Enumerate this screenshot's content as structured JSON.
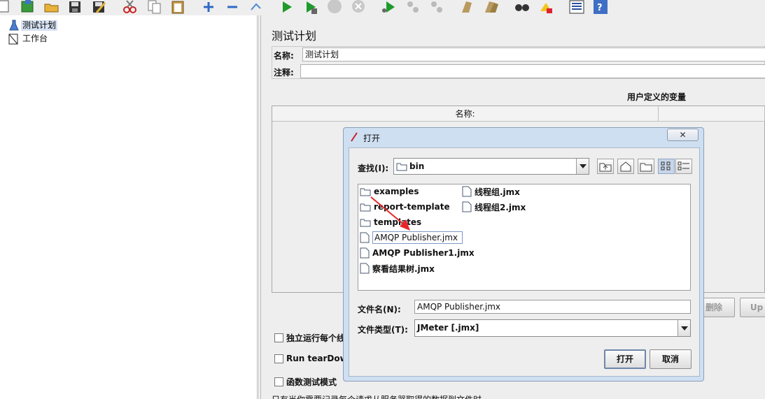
{
  "toolbar": {
    "buttons": [
      "new-icon",
      "templates-icon",
      "open-icon",
      "save-icon",
      "save-as-icon",
      "cut-icon",
      "copy-icon",
      "paste-icon",
      "expand-icon",
      "collapse-icon",
      "toggle-icon",
      "start-icon",
      "start-no-pause-icon",
      "stop-icon",
      "shutdown-icon",
      "remote-start-icon",
      "remote-stop-icon",
      "remote-shutdown-icon",
      "clear-icon",
      "clear-all-icon",
      "search-icon",
      "reset-search-icon",
      "function-helper-icon",
      "help-icon"
    ]
  },
  "tree": {
    "items": [
      {
        "label": "测试计划",
        "icon": "flask-icon"
      },
      {
        "label": "工作台",
        "icon": "workbench-icon"
      }
    ]
  },
  "main": {
    "title": "测试计划",
    "name_label": "名称:",
    "name_value": "测试计划",
    "comment_label": "注释:",
    "comment_value": "",
    "section_title": "用户定义的变量",
    "table_header_name": "名称:",
    "table_header_value": "",
    "delete_button": "删除",
    "up_button": "Up",
    "checkbox_1": "独立运行每个线",
    "checkbox_2": "Run tearDown",
    "checkbox_3": "函数测试模式",
    "bottom_note": "只有当你需要记录每个请求从服务器取得的数据到文件时"
  },
  "dialog": {
    "title": "打开",
    "close_label": "✕",
    "lookin_label": "查找(I):",
    "lookin_value": "bin",
    "files": [
      {
        "name": "examples",
        "type": "folder"
      },
      {
        "name": "report-template",
        "type": "folder"
      },
      {
        "name": "templates",
        "type": "folder"
      },
      {
        "name": "AMQP Publisher.jmx",
        "type": "file",
        "selected": true
      },
      {
        "name": "AMQP Publisher1.jmx",
        "type": "file"
      },
      {
        "name": "察看结果树.jmx",
        "type": "file"
      },
      {
        "name": "线程组.jmx",
        "type": "file"
      },
      {
        "name": "线程组2.jmx",
        "type": "file"
      }
    ],
    "filename_label": "文件名(N):",
    "filename_value": "AMQP Publisher.jmx",
    "filetype_label": "文件类型(T):",
    "filetype_value": "JMeter [.jmx]",
    "open_button": "打开",
    "cancel_button": "取消"
  },
  "colors": {
    "dialog_frame": "#cfdff2",
    "annotation_arrow": "#e8262a",
    "selection": "#d6e1f2"
  }
}
